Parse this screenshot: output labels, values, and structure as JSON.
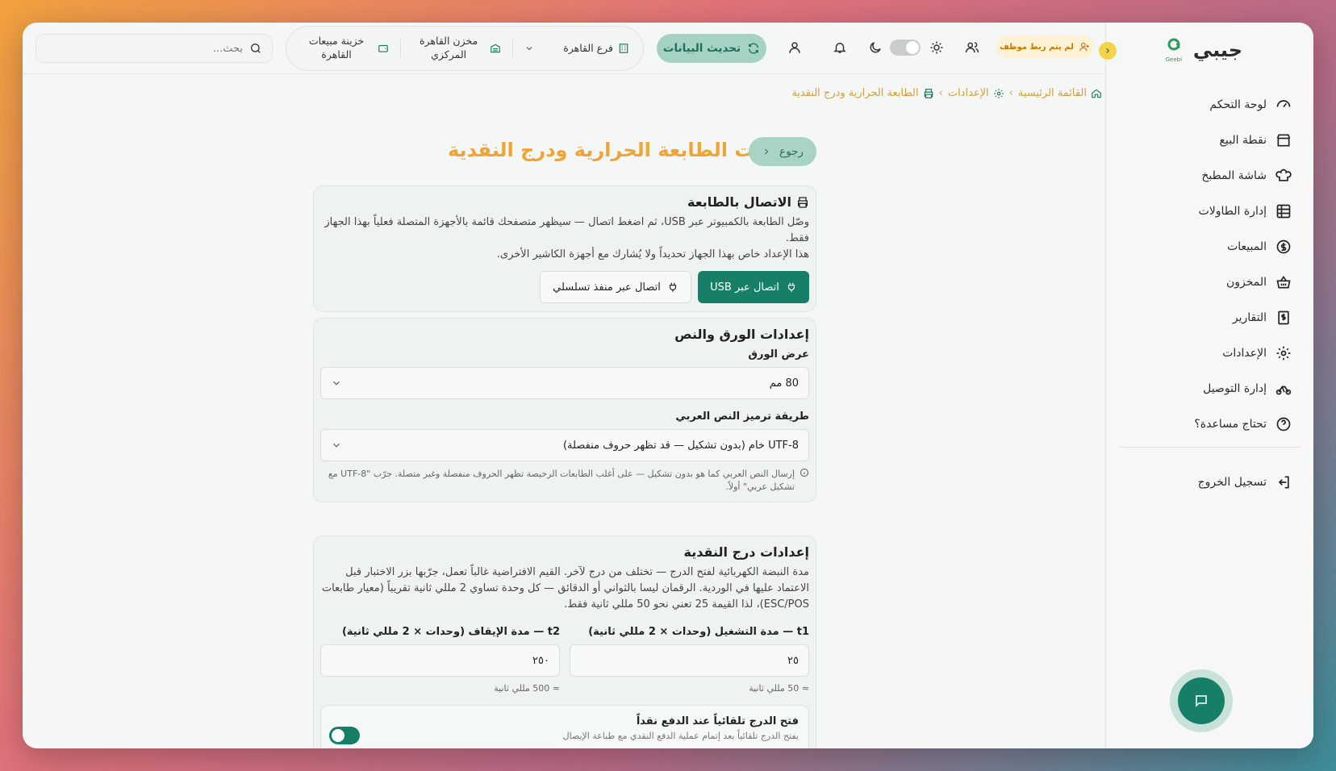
{
  "app": {
    "brand_name": "جيبي",
    "brand_sub": "Geebi"
  },
  "sidebar": {
    "items": [
      {
        "label": "لوحة التحكم",
        "icon": "gauge-icon"
      },
      {
        "label": "نقطة البيع",
        "icon": "store-icon"
      },
      {
        "label": "شاشة المطبخ",
        "icon": "chef-hat-icon"
      },
      {
        "label": "إدارة الطاولات",
        "icon": "grid-table-icon"
      },
      {
        "label": "المبيعات",
        "icon": "dollar-circle-icon"
      },
      {
        "label": "المخزون",
        "icon": "basket-icon"
      },
      {
        "label": "التقارير",
        "icon": "receipt-dollar-icon"
      },
      {
        "label": "الإعدادات",
        "icon": "gear-icon"
      },
      {
        "label": "إدارة التوصيل",
        "icon": "bike-icon"
      },
      {
        "label": "تحتاج مساعدة؟",
        "icon": "help-circle-icon"
      }
    ],
    "logout_label": "تسجيل الخروج"
  },
  "header": {
    "search_placeholder": "بحث...",
    "treasury": "خزينة مبيعات القاهرة",
    "warehouse": "مخزن القاهرة المركزي",
    "branch": "فرع القاهرة",
    "refresh_label": "تحديث البيانات",
    "staff_badge": "لم يتم ربط موظف"
  },
  "breadcrumb": {
    "home": "القائمة الرئيسية",
    "settings": "الإعدادات",
    "current": "الطابعة الحرارية ودرج النقدية"
  },
  "page": {
    "title": "إعدادات الطابعة الحرارية ودرج النقدية",
    "back_label": "رجوع"
  },
  "printer_card": {
    "title": "الاتصال بالطابعة",
    "desc1": "وصّل الطابعة بالكمبيوتر عبر USB، ثم اضغط اتصال — سيظهر متصفحك قائمة بالأجهزة المتصلة فعلياً بهذا الجهاز فقط.",
    "desc2": "هذا الإعداد خاص بهذا الجهاز تحديداً ولا يُشارك مع أجهزة الكاشير الأخرى.",
    "usb_button": "اتصال عبر USB",
    "serial_button": "اتصال عبر منفذ تسلسلي"
  },
  "paper_card": {
    "title": "إعدادات الورق والنص",
    "width_label": "عرض الورق",
    "width_value": "80 مم",
    "encoding_label": "طريقة ترميز النص العربي",
    "encoding_value": "UTF-8 خام (بدون تشكيل — قد تظهر حروف منفصلة)",
    "encoding_hint": "إرسال النص العربي كما هو بدون تشكيل — على أغلب الطابعات الرخيصة تظهر الحروف منفصلة وغير متصلة. جرّب \"UTF-8 مع تشكيل عربي\" أولاً."
  },
  "drawer_card": {
    "title": "إعدادات درج النقدية",
    "desc": "مدة النبضة الكهربائية لفتح الدرج — تختلف من درج لآخر. القيم الافتراضية غالباً تعمل، جرّبها بزر الاختبار قبل الاعتماد عليها في الوردية. الرقمان ليسا بالثواني أو الدقائق — كل وحدة تساوي 2 مللي ثانية تقريباً (معيار طابعات ESC/POS)، لذا القيمة 25 تعني نحو 50 مللي ثانية فقط.",
    "t1_label": "t1 — مدة التشغيل (وحدات × 2 مللي ثانية)",
    "t1_value": "٢٥",
    "t1_approx": "≈ 50 مللي ثانية",
    "t2_label": "t2 — مدة الإيقاف (وحدات × 2 مللي ثانية)",
    "t2_value": "٢٥٠",
    "t2_approx": "≈ 500 مللي ثانية",
    "auto_open_title": "فتح الدرج تلقائياً عند الدفع نقداً",
    "auto_open_desc": "يفتح الدرج تلقائياً بعد إتمام عملية الدفع النقدي مع طباعة الإيصال",
    "auto_open_enabled": true
  },
  "colors": {
    "primary": "#177e68",
    "accent": "#f0a437",
    "soft_green": "#a4d3c3"
  }
}
